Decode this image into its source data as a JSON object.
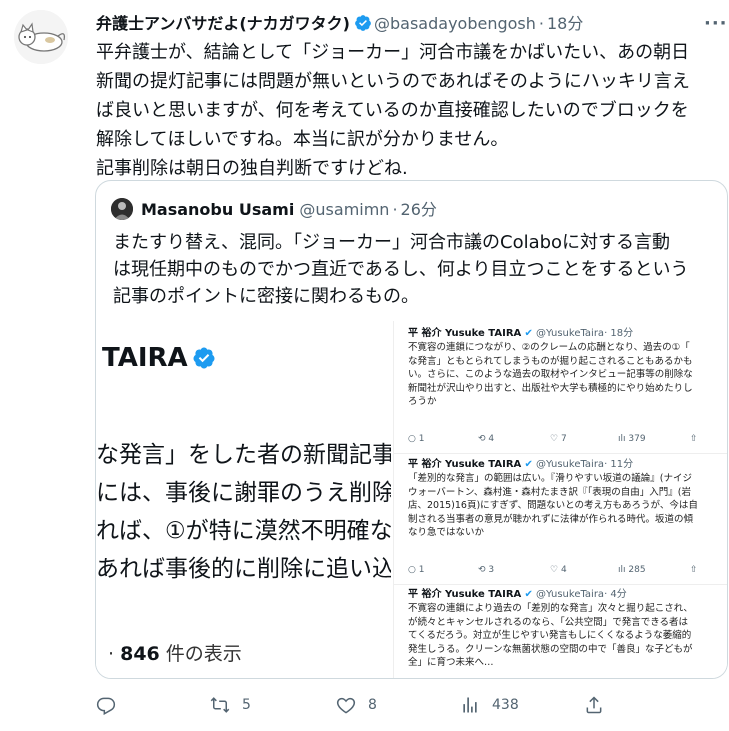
{
  "tweet": {
    "author_name": "弁護士アンバサだよ(ナカガワタク)",
    "handle": "@basadayobengosh",
    "sep": "·",
    "time": "18分",
    "more": "···",
    "body": [
      "平弁護士が、結論として「ジョーカー」河合市議をかばいたい、あの朝日",
      "新聞の提灯記事には問題が無いというのであればそのようにハッキリ言え",
      "ば良いと思いますが、何を考えているのか直接確認したいのでブロックを",
      "解除してほしいですね。本当に訳が分かりません。",
      "記事削除は朝日の独自判断ですけどね."
    ]
  },
  "quote": {
    "author_name": "Masanobu Usami",
    "handle": "@usamimn",
    "sep": "·",
    "time": "26分",
    "body": [
      "またすり替え、混同。「ジョーカー」河合市議のColaboに対する言動",
      "は現任期中のものでかつ直近であるし、何より目立つことをするという",
      "記事のポイントに密接に関わるもの。"
    ]
  },
  "media_left": {
    "name": "TAIRA",
    "lines": [
      "な発言」をした者の新聞記事の",
      "には、事後に謝罪のうえ削除す",
      "れば、①が特に漠然不明確な",
      "あれば事後的に削除に追い込ま"
    ],
    "count_prefix": "· ",
    "count": "846",
    "count_suffix": " 件の表示"
  },
  "media_right": {
    "tweets": [
      {
        "name": "平 裕介 Yusuke TAIRA",
        "handle": "@YusukeTaira",
        "time": "· 18分",
        "lines": [
          "不寛容の連鎖につながり、②のクレームの応酬となり、過去の①「",
          "な発言」ともとられてしまうものが掘り起こされることもあるかも",
          "い。さらに、このような過去の取材やインタビュー記事等の削除な",
          "新聞社が沢山やり出すと、出版社や大学も積極的にやり始めたりし",
          "ろうか"
        ],
        "reply": "1",
        "retweet": "4",
        "like": "7",
        "views": "379"
      },
      {
        "name": "平 裕介 Yusuke TAIRA",
        "handle": "@YusukeTaira",
        "time": "· 11分",
        "lines": [
          "「差別的な発言」の範囲は広い。『滑りやすい坂道の議論』(ナイジ",
          "ウォーバートン、森村進・森村たまき訳『「表現の自由」入門』(岩",
          "店、2015)16頁)にすぎず、問題ないとの考え方もあろうが、今は自",
          "制される当事者の意見が聴かれずに法律が作られる時代。坂道の傾",
          "なり急ではないか"
        ],
        "reply": "1",
        "retweet": "3",
        "like": "4",
        "views": "285"
      },
      {
        "name": "平 裕介 Yusuke TAIRA",
        "handle": "@YusukeTaira",
        "time": "· 4分",
        "lines": [
          "不寛容の連鎖により過去の「差別的な発言」次々と掘り起こされ、",
          "が続々とキャンセルされるのなら、「公共空間」で発言できる者は",
          "てくるだろう。対立が生じやすい発言もしにくくなるような萎縮的",
          "発生しうる。クリーンな無菌状態の空間の中で「善良」な子どもが",
          "全」に育つ未来へ…"
        ]
      }
    ]
  },
  "actions": {
    "reply_count": "",
    "retweet_count": "5",
    "like_count": "8",
    "views_count": "438"
  },
  "colors": {
    "verified": "#1d9bf0",
    "muted": "#536471",
    "border": "#cfd9de"
  }
}
